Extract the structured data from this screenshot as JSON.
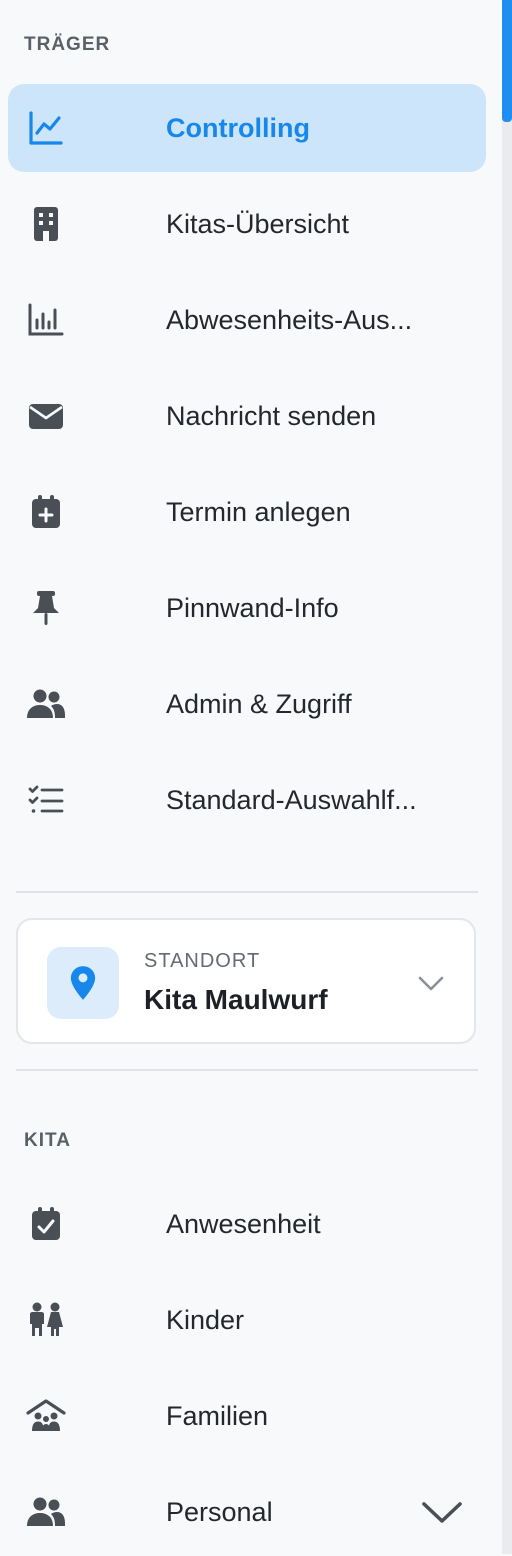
{
  "sections": {
    "traeger_label": "TRÄGER",
    "kita_label": "KITA"
  },
  "traeger_items": [
    {
      "label": "Controlling",
      "icon": "chart-line-icon",
      "active": true
    },
    {
      "label": "Kitas-Übersicht",
      "icon": "building-icon"
    },
    {
      "label": "Abwesenheits-Aus...",
      "icon": "bar-chart-icon"
    },
    {
      "label": "Nachricht senden",
      "icon": "envelope-icon"
    },
    {
      "label": "Termin anlegen",
      "icon": "calendar-plus-icon"
    },
    {
      "label": "Pinnwand-Info",
      "icon": "thumbtack-icon"
    },
    {
      "label": "Admin & Zugriff",
      "icon": "users-icon"
    },
    {
      "label": "Standard-Auswahlf...",
      "icon": "checklist-icon"
    }
  ],
  "location": {
    "label": "STANDORT",
    "value": "Kita Maulwurf"
  },
  "kita_items": [
    {
      "label": "Anwesenheit",
      "icon": "calendar-check-icon"
    },
    {
      "label": "Kinder",
      "icon": "children-icon"
    },
    {
      "label": "Familien",
      "icon": "family-house-icon"
    },
    {
      "label": "Personal",
      "icon": "users-icon"
    }
  ],
  "colors": {
    "accent": "#1787ec",
    "active_bg": "#cce5fa",
    "icon": "#4a4f56",
    "background": "#f8f9fb"
  }
}
